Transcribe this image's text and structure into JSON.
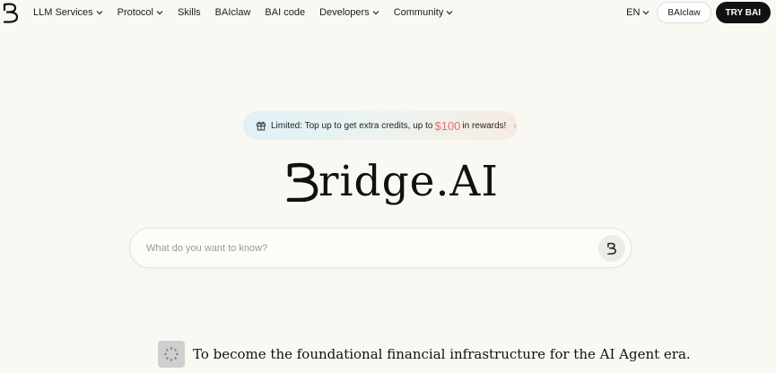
{
  "nav": {
    "logo_icon": "bridge-logo-icon",
    "items": [
      {
        "label": "LLM Services",
        "dropdown": true
      },
      {
        "label": "Protocol",
        "dropdown": true
      },
      {
        "label": "Skills",
        "dropdown": false
      },
      {
        "label": "BAIclaw",
        "dropdown": false
      },
      {
        "label": "BAI code",
        "dropdown": false
      },
      {
        "label": "Developers",
        "dropdown": true
      },
      {
        "label": "Community",
        "dropdown": true
      }
    ],
    "language": "EN",
    "baiclaw_button": "BAIclaw",
    "try_button": "TRY BAI"
  },
  "promo": {
    "icon": "gift-icon",
    "text_before": "Limited: Top up to get extra credits, up to",
    "amount": "$100",
    "text_after": "in rewards!",
    "arrow": "›"
  },
  "brand": {
    "text": "ridge.AI"
  },
  "search": {
    "placeholder": "What do you want to know?",
    "value": ""
  },
  "mission": {
    "icon": "loading-spinner-icon",
    "text": "To become the foundational financial infrastructure for the AI Agent era."
  },
  "colors": {
    "background": "#faf8f3",
    "primary": "#111111",
    "promo_amount": "#ef6a6a"
  }
}
